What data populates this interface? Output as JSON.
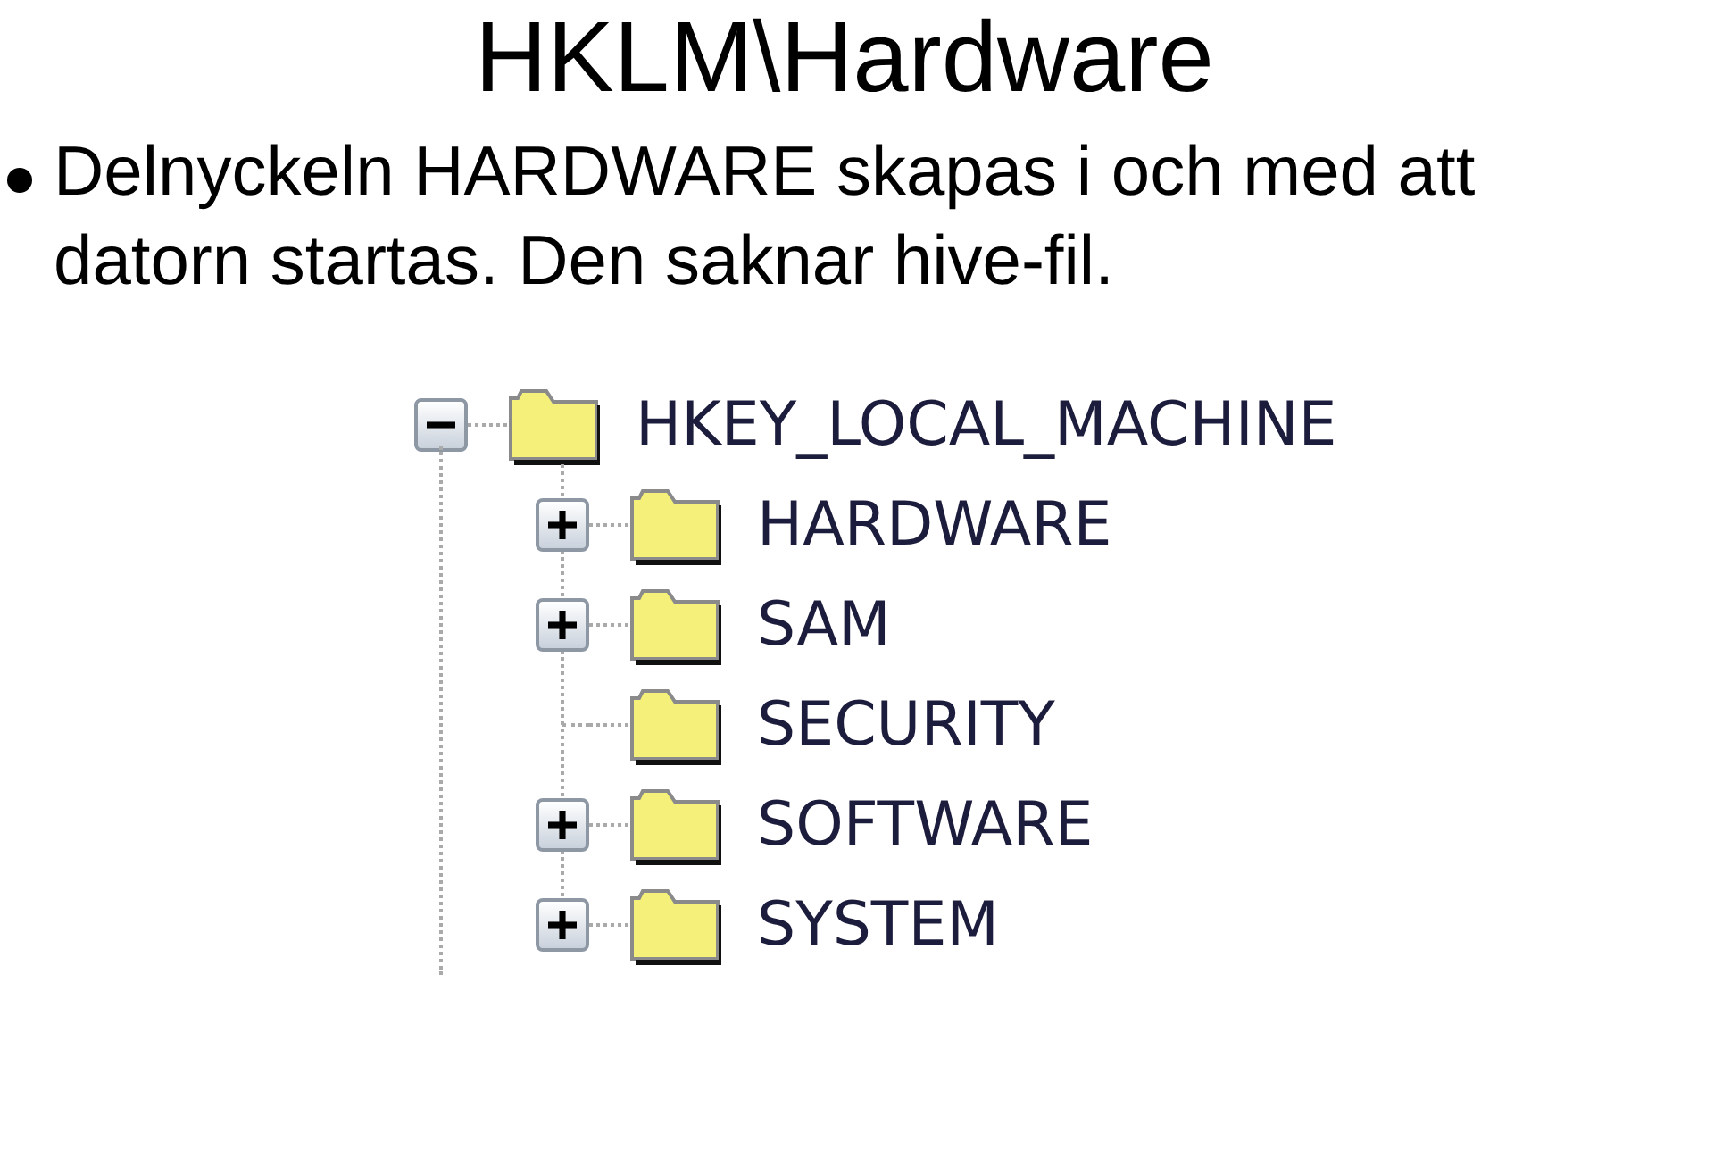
{
  "title": "HKLM\\Hardware",
  "bullets": [
    "Delnyckeln HARDWARE skapas i och med att datorn startas. Den saknar hive-fil."
  ],
  "tree": {
    "label": "HKEY_LOCAL_MACHINE",
    "expanded": true,
    "children": [
      {
        "label": "HARDWARE",
        "expandable": true
      },
      {
        "label": "SAM",
        "expandable": true
      },
      {
        "label": "SECURITY",
        "expandable": false
      },
      {
        "label": "SOFTWARE",
        "expandable": true
      },
      {
        "label": "SYSTEM",
        "expandable": true
      }
    ]
  }
}
